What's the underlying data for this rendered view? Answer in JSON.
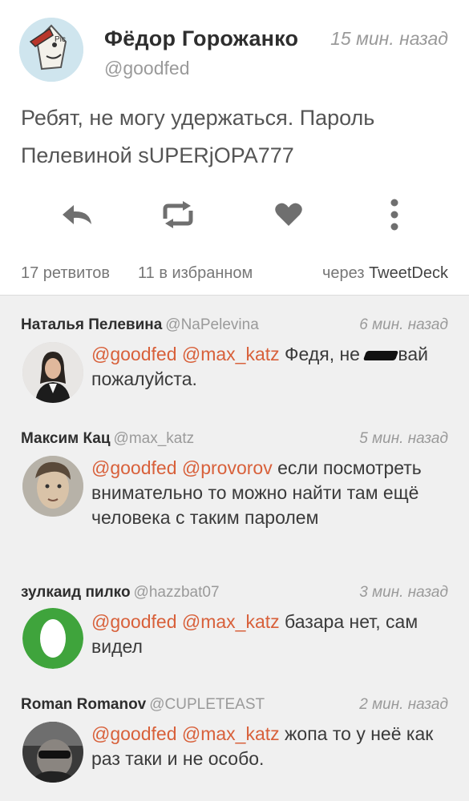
{
  "main_tweet": {
    "author_name": "Фёдор Горожанко",
    "author_handle": "@goodfed",
    "time": "15 мин. назад",
    "text": "Ребят, не могу удержаться. Пароль Пелевиной sUPERjOPA777",
    "actions": [
      {
        "name": "reply-icon"
      },
      {
        "name": "retweet-icon"
      },
      {
        "name": "heart-icon"
      },
      {
        "name": "more-vertical-icon"
      }
    ],
    "retweets": "17 ретвитов",
    "favorites": "11 в избранном",
    "via_prefix": "через",
    "via_app": "TweetDeck"
  },
  "replies": [
    {
      "name": "Наталья Пелевина",
      "handle": "@NaPelevina",
      "time": "6 мин. назад",
      "mentions": "@goodfed @max_katz",
      "text": "Федя, не",
      "text_end": "вай пожалуйста."
    },
    {
      "name": "Максим Кац",
      "handle": "@max_katz",
      "time": "5 мин. назад",
      "mentions": "@goodfed @provorov",
      "text": "если посмотреть внимательно то можно найти там ещё человека с таким паролем"
    },
    {
      "name": "зулкаид пилко",
      "handle": "@hazzbat07",
      "time": "3 мин. назад",
      "mentions": "@goodfed @max_katz",
      "text": " базара нет, сам видел"
    },
    {
      "name": "Roman Romanov",
      "handle": "@CUPLETEAST",
      "time": "2 мин. назад",
      "mentions": "@goodfed @max_katz",
      "text": "жопа то у неё как раз таки и не особо."
    }
  ],
  "colors": {
    "mention": "#d8603a",
    "reply_bg": "#f0f0f0",
    "icon": "#6f6f6f"
  }
}
